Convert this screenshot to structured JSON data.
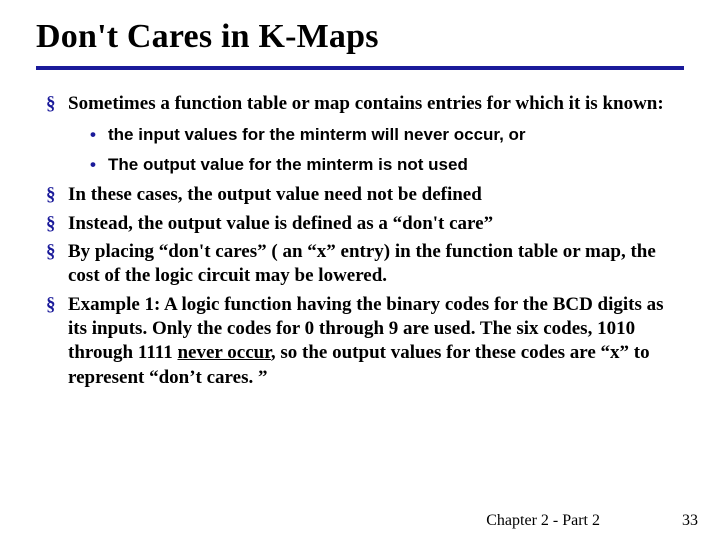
{
  "title": "Don't Cares in K-Maps",
  "bullets": {
    "b1": "Sometimes a function table or map contains entries for which it is known:",
    "sub1": "the input values for the minterm will never occur, or",
    "sub2": "The output value for the minterm is not used",
    "b2": "In these cases, the output value need not be defined",
    "b3": "Instead, the output value is defined as a “don't care”",
    "b4": "By placing “don't cares” ( an “x” entry) in the function table or map, the cost of the logic circuit may be lowered.",
    "b5a": "Example  1:  A logic function having the binary codes for the BCD digits as its inputs. Only the codes for 0 through 9 are used.  The six codes, 1010 through 1111 ",
    "b5u": "never occur",
    "b5b": ", so the output values for these codes are “x” to represent “don’t cares. ”"
  },
  "footer": {
    "chapter": "Chapter 2 - Part 2",
    "page": "33"
  }
}
